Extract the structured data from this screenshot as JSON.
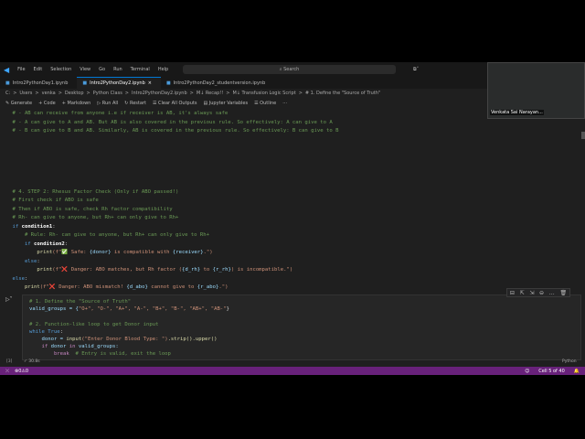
{
  "menu": [
    "File",
    "Edit",
    "Selection",
    "View",
    "Go",
    "Run",
    "Terminal",
    "Help"
  ],
  "search_placeholder": "Search",
  "tabs": [
    {
      "label": "Intro2PythonDay1.ipynb"
    },
    {
      "label": "Intro2PythonDay2.ipynb",
      "close": "×"
    },
    {
      "label": "Intro2PythonDay2_studentversion.ipynb"
    }
  ],
  "breadcrumb": [
    "C:",
    "Users",
    "venka",
    "Desktop",
    "Python Class",
    "Intro2PythonDay2.ipynb",
    "M↓ Recap!!",
    "M↓ Transfusion Logic Script",
    "# 1. Define the \"Source of Truth\""
  ],
  "toolbar": [
    "Generate",
    "+ Code",
    "+ Markdown",
    "Run All",
    "Restart",
    "Clear All Outputs",
    "Jupyter Variables",
    "Outline",
    "···"
  ],
  "cell1": [
    [
      [
        "    # - AB can receive from anyone i.e if receiver is AB, it's always safe",
        "c"
      ]
    ],
    [
      [
        "    # - A can give to A and AB. But AB is also covered in the previous rule. So effectively: A can give to A",
        "c"
      ]
    ],
    [
      [
        "    # - B can give to B and AB. Similarly, AB is covered in the previous rule. So effectively: B can give to B",
        "c"
      ]
    ],
    [],
    [],
    [],
    [],
    [],
    [],
    [
      [
        "    # 4. STEP 2: Rhesus Factor Check (Only if ABO passed!)",
        "c"
      ]
    ],
    [
      [
        "    # First check if ABO is safe",
        "c"
      ]
    ],
    [
      [
        "    # Then if ABO is safe, check Rh factor compatibility",
        "c"
      ]
    ],
    [
      [
        "    # Rh- can give to anyone, but Rh+ can only give to Rh+",
        "c"
      ]
    ],
    [
      [
        "    if ",
        "k"
      ],
      [
        "condition1",
        "b"
      ],
      [
        ":",
        "w"
      ]
    ],
    [
      [
        "        # Rule: Rh- can give to anyone, but Rh+ can only give to Rh+",
        "c"
      ]
    ],
    [
      [
        "        if ",
        "k"
      ],
      [
        "condition2",
        "b"
      ],
      [
        ":",
        "w"
      ]
    ],
    [
      [
        "            print",
        "f"
      ],
      [
        "(f\"",
        "s"
      ],
      [
        "✅",
        "w"
      ],
      [
        " Safe: ",
        "s"
      ],
      [
        "{donor}",
        "v"
      ],
      [
        " is compatible with ",
        "s"
      ],
      [
        "{receiver}",
        "v"
      ],
      [
        ".\")",
        "s"
      ]
    ],
    [
      [
        "        else",
        "k"
      ],
      [
        ":",
        "w"
      ]
    ],
    [
      [
        "            print",
        "f"
      ],
      [
        "(f\"",
        "s"
      ],
      [
        "❌",
        "w"
      ],
      [
        " Danger: ABO matches, but Rh factor (",
        "s"
      ],
      [
        "{d_rh}",
        "v"
      ],
      [
        " to ",
        "s"
      ],
      [
        "{r_rh}",
        "v"
      ],
      [
        ") is incompatible.\")",
        "s"
      ]
    ],
    [
      [
        "    else",
        "k"
      ],
      [
        ":",
        "w"
      ]
    ],
    [
      [
        "        print",
        "f"
      ],
      [
        "(f\"",
        "s"
      ],
      [
        "❌",
        "w"
      ],
      [
        " Danger: ABO mismatch! ",
        "s"
      ],
      [
        "{d_abo}",
        "v"
      ],
      [
        " cannot give to ",
        "s"
      ],
      [
        "{r_abo}",
        "v"
      ],
      [
        ".\")",
        "s"
      ]
    ]
  ],
  "cell2": [
    [
      [
        "# 1. Define the \"Source of Truth\"",
        "c"
      ]
    ],
    [
      [
        "valid_groups = {",
        "v"
      ],
      [
        "\"O+\", \"O-\", \"A+\", \"A-\", \"B+\", \"B-\", \"AB+\", \"AB-\"",
        "s"
      ],
      [
        "}",
        "w"
      ]
    ],
    [
      [
        "",
        ""
      ]
    ],
    [
      [
        "# 2. Function-like loop to get Donor input",
        "c"
      ]
    ],
    [
      [
        "while True",
        "k"
      ],
      [
        ":",
        "w"
      ]
    ],
    [
      [
        "    donor = ",
        "v"
      ],
      [
        "input",
        "f"
      ],
      [
        "(\"Enter Donor Blood Type: \")",
        "s"
      ],
      [
        ".strip().upper()",
        "f"
      ]
    ],
    [
      [
        "    if ",
        "p"
      ],
      [
        "donor ",
        "v"
      ],
      [
        "in ",
        "p"
      ],
      [
        "valid_groups:",
        "v"
      ]
    ],
    [
      [
        "        break",
        "p"
      ],
      [
        "  # Entry is valid, exit the loop",
        "c"
      ]
    ]
  ],
  "cell2_exec": "[3]",
  "cell2_time": "✓ 30.8s",
  "cell2_lang": "Python",
  "status": {
    "errors": "0",
    "warnings": "0",
    "cell": "Cell 5 of 40"
  },
  "webcam_name": "Venkata Sai Narayan..."
}
